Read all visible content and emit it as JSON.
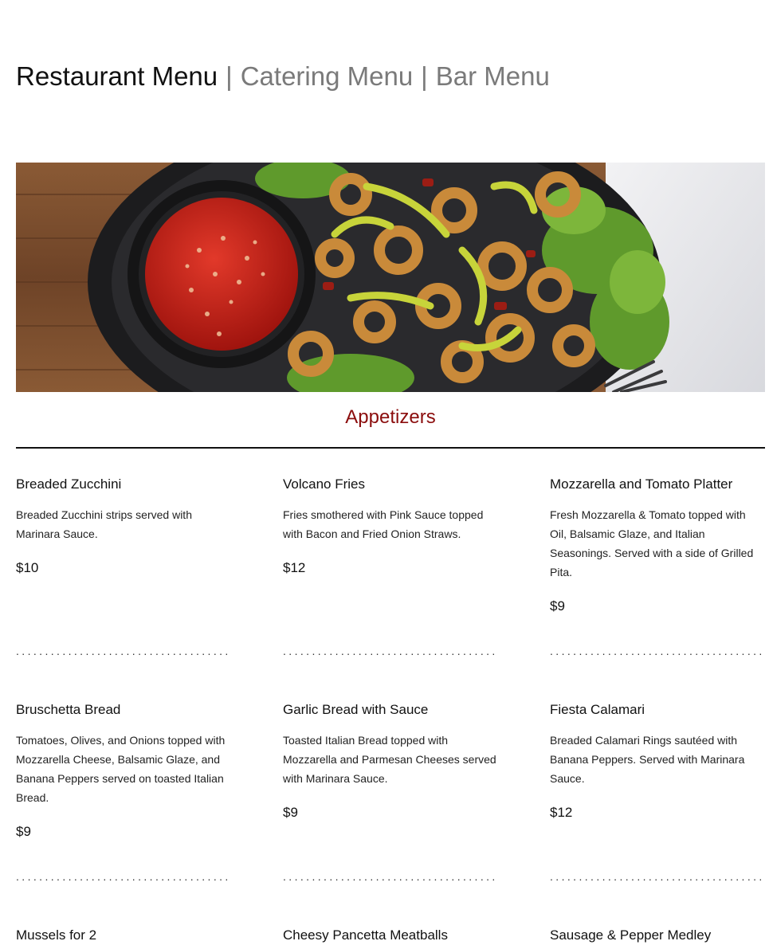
{
  "menu_tabs": {
    "restaurant": "Restaurant Menu",
    "separator": "|",
    "catering": "Catering Menu",
    "bar": "Bar Menu"
  },
  "section": {
    "title": "Appetizers"
  },
  "items": [
    {
      "name": "Breaded Zucchini",
      "description": "Breaded Zucchini strips served with Marinara Sauce.",
      "price": "$10"
    },
    {
      "name": "Volcano Fries",
      "description": "Fries smothered with Pink Sauce topped with Bacon and Fried Onion Straws.",
      "price": "$12"
    },
    {
      "name": "Mozzarella and Tomato Platter",
      "description": "Fresh Mozzarella & Tomato topped with Oil, Balsamic Glaze, and Italian Seasonings. Served with a side of Grilled Pita.",
      "price": "$9"
    },
    {
      "name": "Bruschetta Bread",
      "description": "Tomatoes, Olives, and Onions topped with Mozzarella Cheese, Balsamic Glaze, and Banana Peppers served on toasted Italian Bread.",
      "price": "$9"
    },
    {
      "name": "Garlic Bread with Sauce",
      "description": "Toasted Italian Bread topped with Mozzarella and Parmesan Cheeses served with Marinara Sauce.",
      "price": "$9"
    },
    {
      "name": "Fiesta Calamari",
      "description": "Breaded Calamari Rings sautéed with Banana Peppers. Served with Marinara Sauce.",
      "price": "$12"
    },
    {
      "name": "Mussels for 2",
      "description": "",
      "price": ""
    },
    {
      "name": "Cheesy Pancetta Meatballs",
      "description": "",
      "price": ""
    },
    {
      "name": "Sausage & Pepper Medley",
      "description": "",
      "price": ""
    }
  ],
  "separator_dots": "................................................"
}
